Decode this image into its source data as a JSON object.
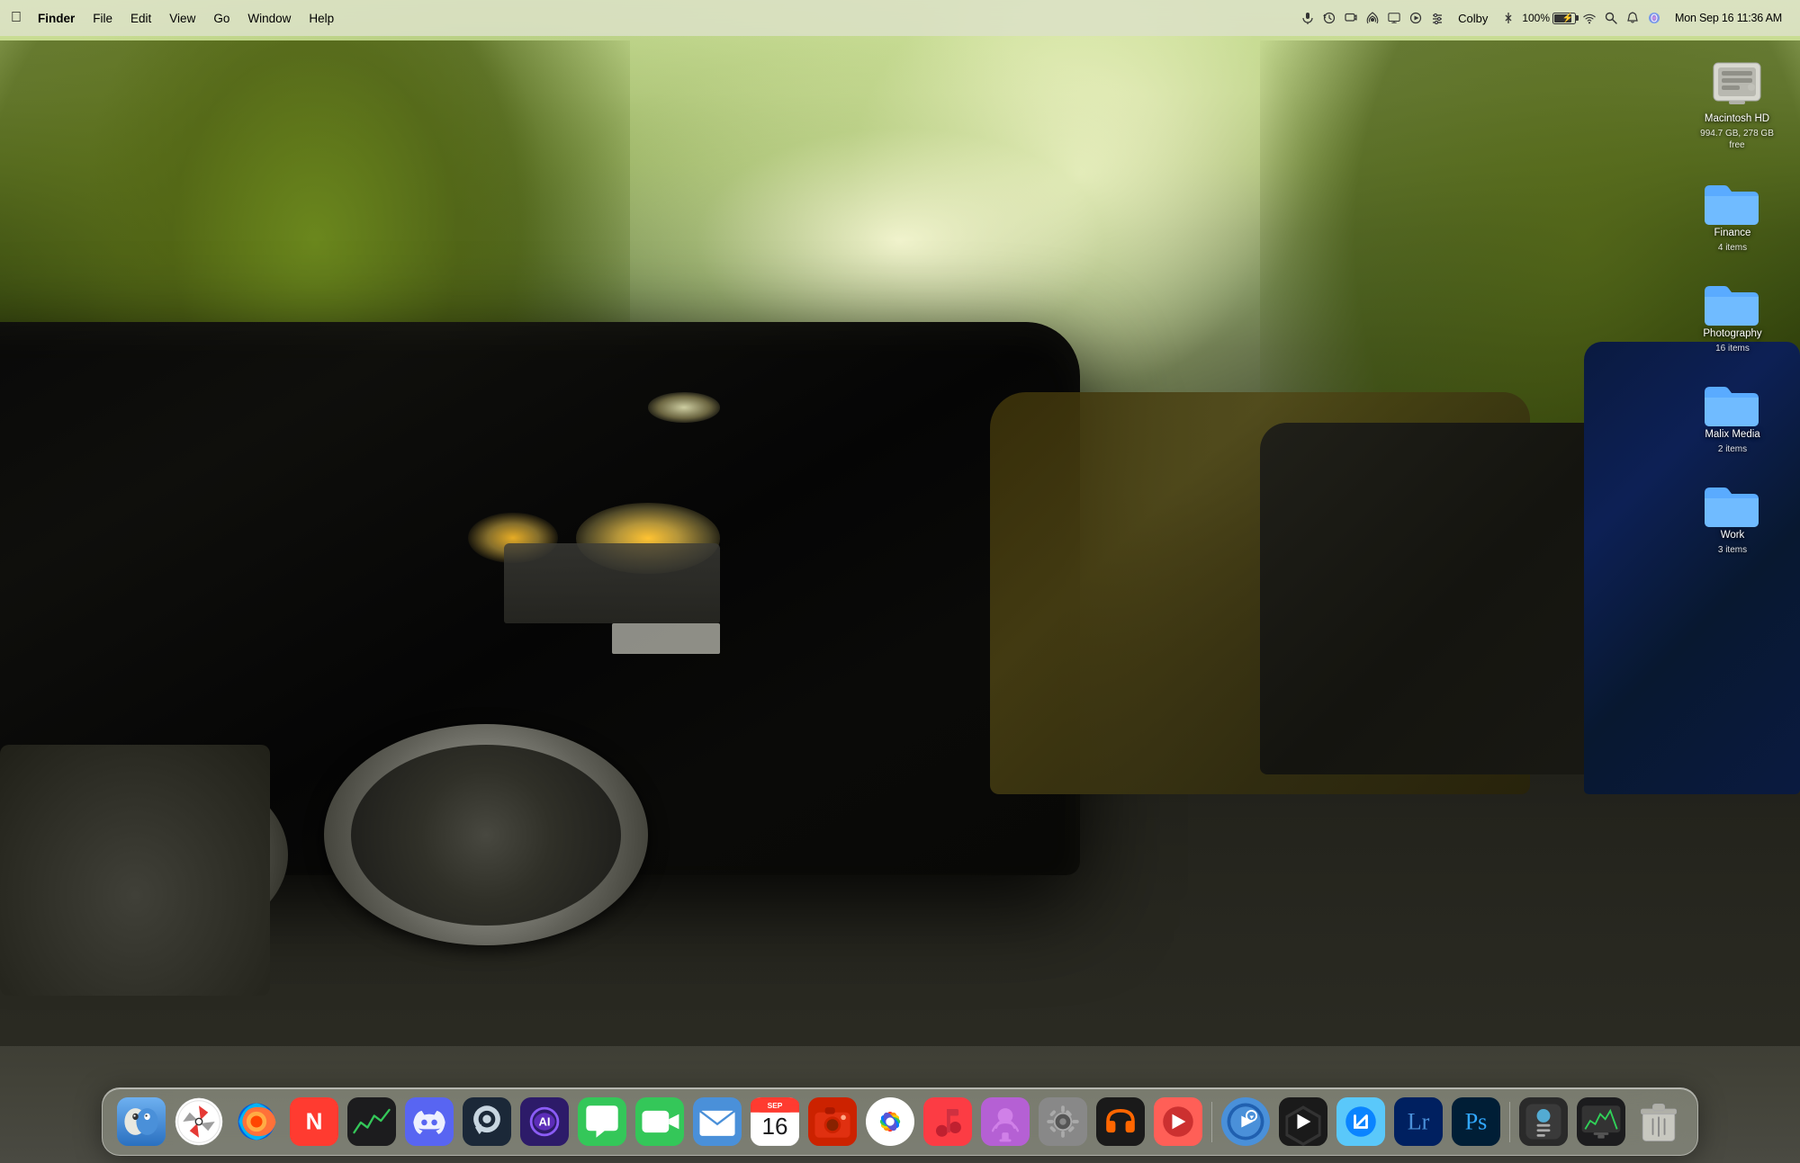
{
  "menubar": {
    "apple": "🍎",
    "finder": "Finder",
    "menus": [
      "File",
      "Edit",
      "View",
      "Go",
      "Window",
      "Help"
    ],
    "right_items": {
      "mic_icon": "🎙",
      "clock_icon": "⏰",
      "screen_icon": "⬛",
      "airdrop_icon": "📡",
      "display_icon": "🖥",
      "play_icon": "▶",
      "controls_icon": "🎛",
      "user": "Colby",
      "bluetooth": "🔷",
      "battery_pct": "100%",
      "battery_charging": true,
      "wifi": "WiFi",
      "search": "🔍",
      "notification": "🔔",
      "siri": "◎",
      "datetime": "Mon Sep 16  11:36 AM"
    }
  },
  "desktop": {
    "wallpaper_desc": "Black Mercedes-Benz cars lined up at car show, autumn trees"
  },
  "desktop_items": [
    {
      "id": "macintosh-hd",
      "label": "Macintosh HD",
      "sublabel": "994.7 GB, 278 GB free",
      "type": "drive",
      "color": "#e0e0e0"
    },
    {
      "id": "finance",
      "label": "Finance",
      "sublabel": "4 items",
      "type": "folder",
      "color": "#5aabff"
    },
    {
      "id": "photography",
      "label": "Photography",
      "sublabel": "16 items",
      "type": "folder",
      "color": "#5aabff"
    },
    {
      "id": "malix-media",
      "label": "Malix Media",
      "sublabel": "2 items",
      "type": "folder",
      "color": "#5aabff"
    },
    {
      "id": "work",
      "label": "Work",
      "sublabel": "3 items",
      "type": "folder",
      "color": "#5aabff"
    }
  ],
  "dock": {
    "items": [
      {
        "id": "finder",
        "label": "Finder",
        "color": "#4a90d9"
      },
      {
        "id": "safari",
        "label": "Safari",
        "color": "#0fb5ee"
      },
      {
        "id": "firefox",
        "label": "Firefox",
        "color": "#ff7139"
      },
      {
        "id": "news",
        "label": "News",
        "color": "#ff3b30"
      },
      {
        "id": "stocks",
        "label": "Stocks",
        "color": "#1c1c1e"
      },
      {
        "id": "discord",
        "label": "Discord",
        "color": "#5865f2"
      },
      {
        "id": "steam",
        "label": "Steam",
        "color": "#1b2838"
      },
      {
        "id": "ai-tool",
        "label": "AI Tool",
        "color": "#8b5cf6"
      },
      {
        "id": "messages",
        "label": "Messages",
        "color": "#34c759"
      },
      {
        "id": "facetime",
        "label": "FaceTime",
        "color": "#34c759"
      },
      {
        "id": "mail",
        "label": "Mail",
        "color": "#4a90d9"
      },
      {
        "id": "calendar",
        "label": "Calendar",
        "color": "#ff3b30"
      },
      {
        "id": "photos-capture",
        "label": "Photo Capture",
        "color": "#ff6b6b"
      },
      {
        "id": "photos",
        "label": "Photos",
        "color": "#ff9f0a"
      },
      {
        "id": "music",
        "label": "Music",
        "color": "#fc3c44"
      },
      {
        "id": "podcasts",
        "label": "Podcasts",
        "color": "#b560d4"
      },
      {
        "id": "system-prefs",
        "label": "System Preferences",
        "color": "#888"
      },
      {
        "id": "audacity",
        "label": "Audacity",
        "color": "#ff6600"
      },
      {
        "id": "garageband",
        "label": "GarageBand",
        "color": "#ff5f57"
      },
      {
        "id": "quicktime",
        "label": "QuickTime",
        "color": "#4a90d9"
      },
      {
        "id": "final-cut",
        "label": "Final Cut Pro",
        "color": "#999"
      },
      {
        "id": "compressor",
        "label": "Compressor",
        "color": "#5ac8fa"
      },
      {
        "id": "lightroom",
        "label": "Lightroom",
        "color": "#4a90d9"
      },
      {
        "id": "photoshop",
        "label": "Photoshop",
        "color": "#31a8ff"
      },
      {
        "id": "airdrop-dock",
        "label": "AirDrop",
        "color": "#5ac8fa"
      },
      {
        "id": "istat",
        "label": "iStat Menus",
        "color": "#333"
      },
      {
        "id": "trash",
        "label": "Trash",
        "color": "#888"
      }
    ]
  }
}
